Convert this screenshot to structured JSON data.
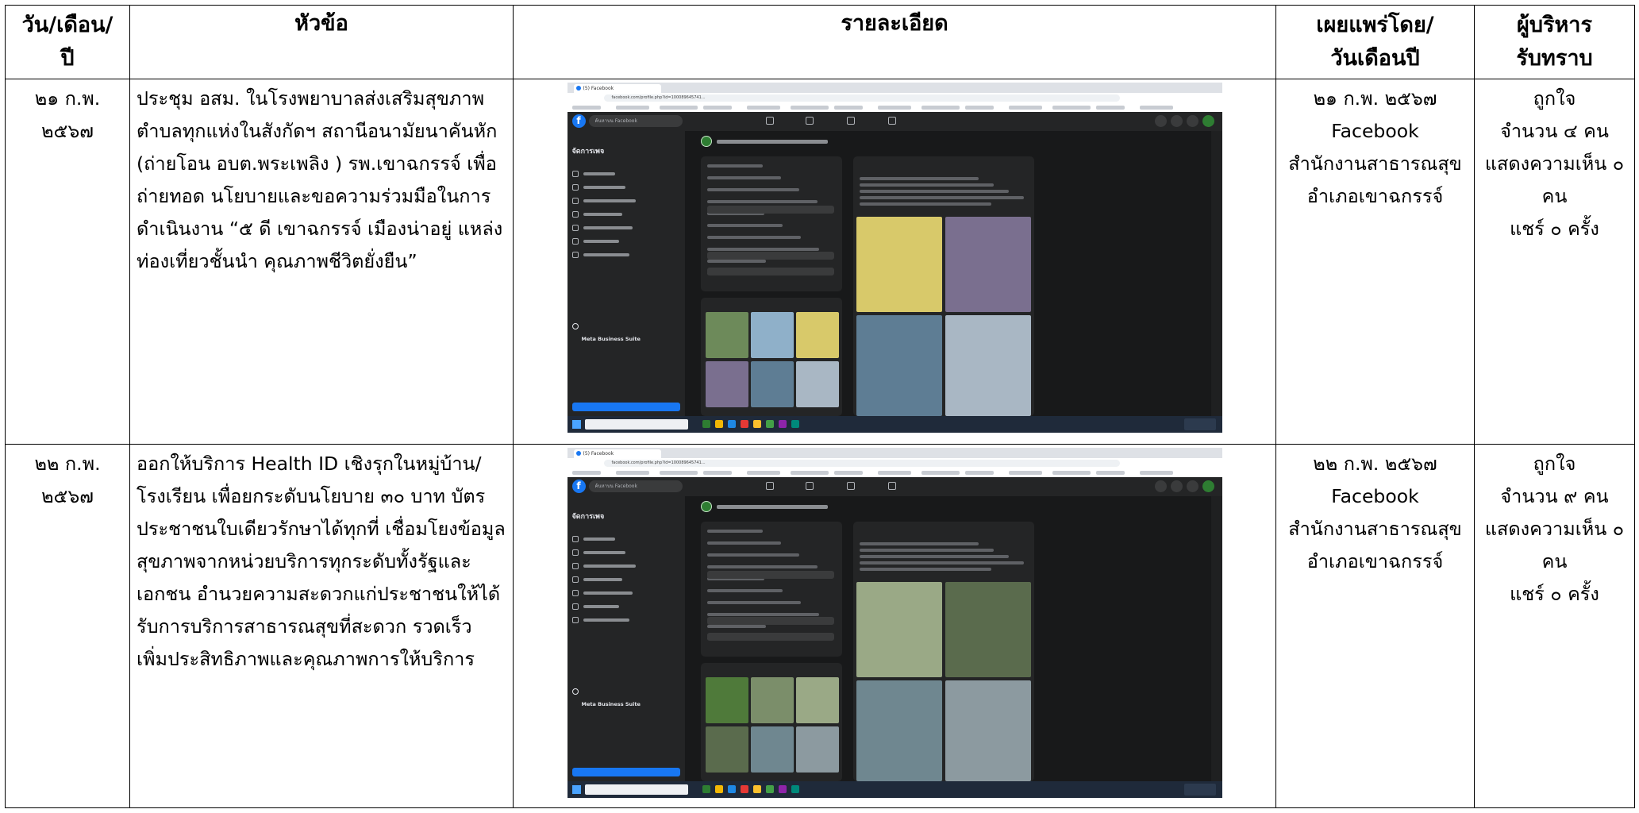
{
  "table": {
    "headers": [
      "วัน/เดือน/ปี",
      "หัวข้อ",
      "รายละเอียด",
      "เผยแพร่โดย/ วันเดือนปี",
      "ผู้บริหาร รับทราบ"
    ],
    "header_lines": {
      "date": [
        "วัน/เดือน/",
        "ปี"
      ],
      "topic": [
        "หัวข้อ"
      ],
      "detail": [
        "รายละเอียด"
      ],
      "publisher": [
        "เผยแพร่โดย/",
        "วันเดือนปี"
      ],
      "executive": [
        "ผู้บริหาร",
        "รับทราบ"
      ]
    },
    "rows": [
      {
        "date_lines": [
          "๒๑ ก.พ.",
          "๒๕๖๗"
        ],
        "topic": "ประชุม อสม. ในโรงพยาบาลส่งเสริมสุขภาพตำบลทุกแห่งในสังกัดฯ สถานีอนามัยนาคันหัก (ถ่ายโอน อบต.พระเพลิง ) รพ.เขาฉกรรจ์ เพื่อถ่ายทอด นโยบายและขอความร่วมมือในการดำเนินงาน “๕ ดี เขาฉกรรจ์  เมืองน่าอยู่ แหล่งท่องเที่ยวชั้นนำ คุณภาพชีวิตยั่งยืน”",
        "published_lines": [
          "๒๑ ก.พ. ๒๕๖๗",
          "Facebook",
          "สำนักงานสาธารณสุข",
          "อำเภอเขาฉกรรจ์"
        ],
        "feedback_lines": [
          "ถูกใจ",
          "จำนวน ๔ คน",
          "แสดงความเห็น ๐",
          "คน",
          "แชร์ ๐ ครั้ง"
        ],
        "screenshot": {
          "tab_title": "(5) Facebook",
          "url": "facebook.com/profile.php?id=100089645741...",
          "search_placeholder": "ค้นหาบน Facebook",
          "side_title": "จัดการเพจ",
          "meta_label": "Meta Business Suite",
          "photo_colors": [
            "#6d8a5a",
            "#8fb0c9",
            "#d8c96a",
            "#7a6f8f",
            "#5e7d94",
            "#a9b7c4",
            "#4f6f4a",
            "#c9a44f"
          ]
        }
      },
      {
        "date_lines": [
          "๒๒ ก.พ.",
          "๒๕๖๗"
        ],
        "topic": "ออกให้บริการ Health ID  เชิงรุกในหมู่บ้าน/โรงเรียน เพื่อยกระดับนโยบาย ๓๐ บาท บัตรประชาชนใบเดียวรักษาได้ทุกที่ เชื่อมโยงข้อมูลสุขภาพจากหน่วยบริการทุกระดับทั้งรัฐและเอกชน อำนวยความสะดวกแก่ประชาชนให้ได้รับการบริการสาธารณสุขที่สะดวก รวดเร็ว เพิ่มประสิทธิภาพและคุณภาพการให้บริการ",
        "published_lines": [
          "๒๒ ก.พ. ๒๕๖๗",
          "Facebook",
          "สำนักงานสาธารณสุข",
          "อำเภอเขาฉกรรจ์"
        ],
        "feedback_lines": [
          "ถูกใจ",
          "จำนวน ๙ คน",
          "แสดงความเห็น ๐",
          "คน",
          "แชร์ ๐ ครั้ง"
        ],
        "screenshot": {
          "tab_title": "(5) Facebook",
          "url": "facebook.com/profile.php?id=100089645741...",
          "search_placeholder": "ค้นหาบน Facebook",
          "side_title": "จัดการเพจ",
          "meta_label": "Meta Business Suite",
          "photo_colors": [
            "#4f7a3a",
            "#7b8e6a",
            "#9aa986",
            "#5a6b4d",
            "#6f8790",
            "#8c9aa0",
            "#3e5e35",
            "#b9a27a"
          ]
        }
      }
    ]
  }
}
